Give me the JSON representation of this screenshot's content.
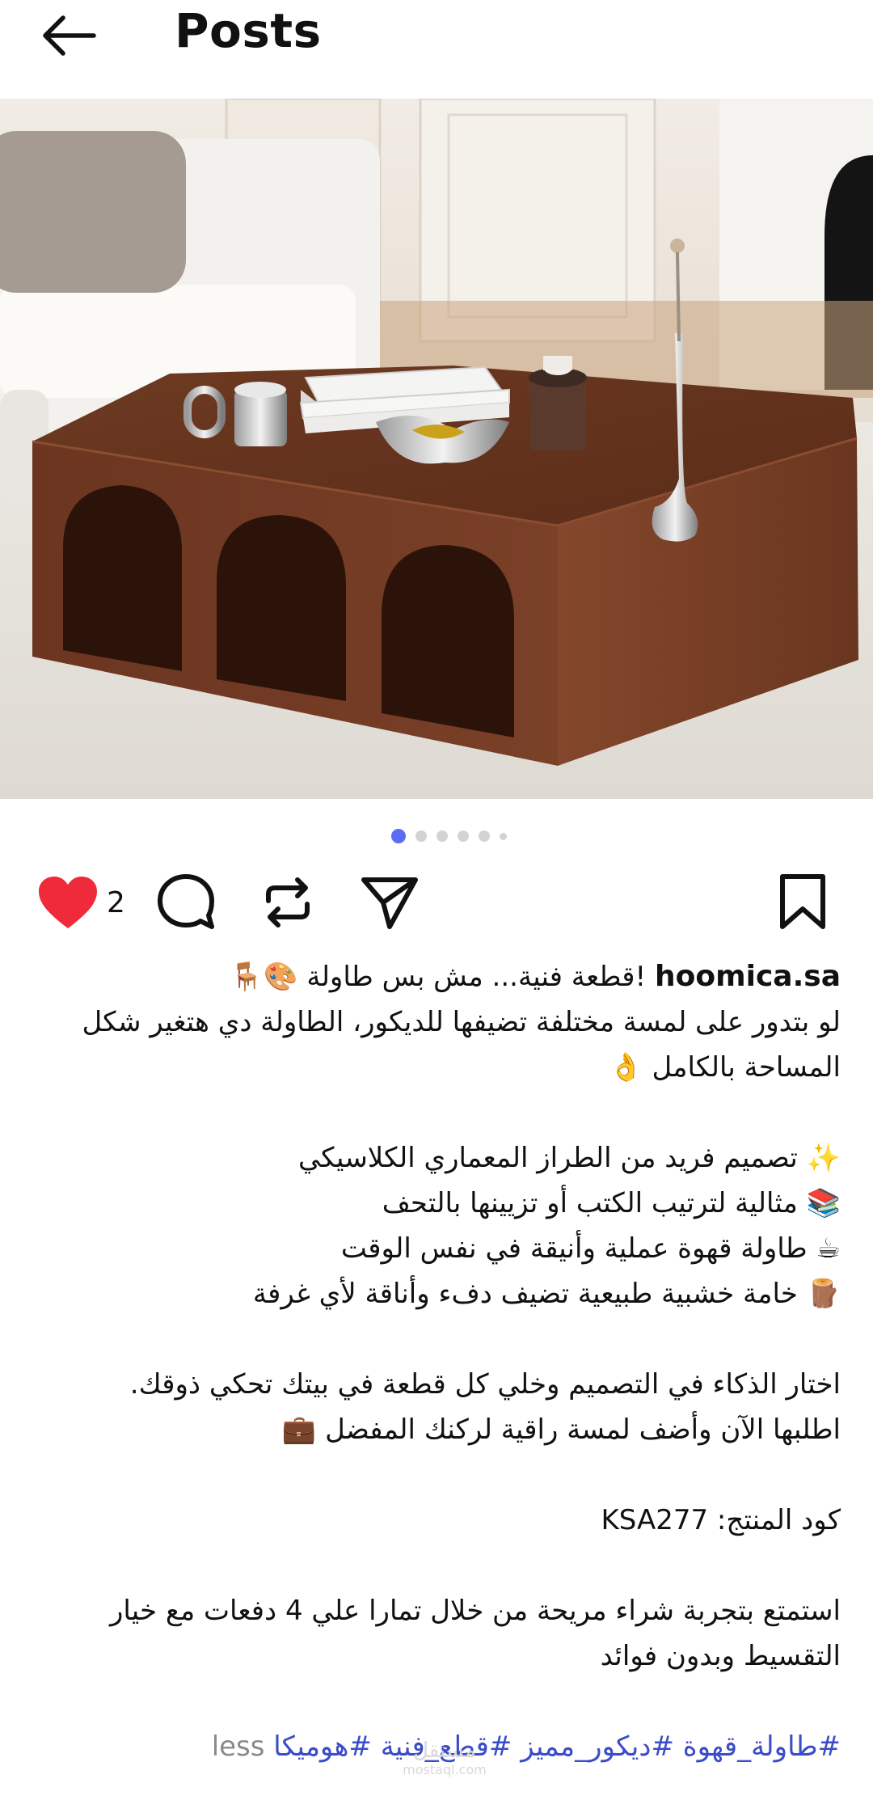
{
  "header": {
    "title": "Posts",
    "back_icon": "arrow-left-icon"
  },
  "carousel": {
    "count": 6,
    "active_index": 0,
    "accent": "#5b6cf5"
  },
  "actions": {
    "like_count": "2",
    "liked": true,
    "like_color": "#ee2a3b"
  },
  "caption": {
    "username": "hoomica.sa",
    "headline": "!قطعة فنية... مش بس طاولة 🎨🪑",
    "intro": "لو بتدور على لمسة مختلفة تضيفها للديكور، الطاولة دي هتغير شكل المساحة بالكامل 👌",
    "features": [
      "✨ تصميم فريد من الطراز المعماري الكلاسيكي",
      "📚 مثالية لترتيب الكتب أو تزيينها بالتحف",
      "☕ طاولة قهوة عملية وأنيقة في نفس الوقت",
      "🪵 خامة خشبية طبيعية تضيف دفء وأناقة لأي غرفة"
    ],
    "closing_1": "اختار الذكاء في التصميم وخلي كل قطعة في بيتك تحكي ذوقك.",
    "closing_2": "اطلبها الآن وأضف لمسة راقية لركنك المفضل 💼",
    "product_code": "كود المنتج: KSA277",
    "installments": "استمتع بتجربة شراء مريحة من خلال تمارا علي 4 دفعات مع خيار التقسيط وبدون فوائد",
    "hashtags": "#طاولة_قهوة #ديكور_مميز #قطع_فنية #هوميكا",
    "less_label": "less"
  },
  "watermark": {
    "text_ar": "مستقل",
    "text_en": "mostaql.com"
  }
}
